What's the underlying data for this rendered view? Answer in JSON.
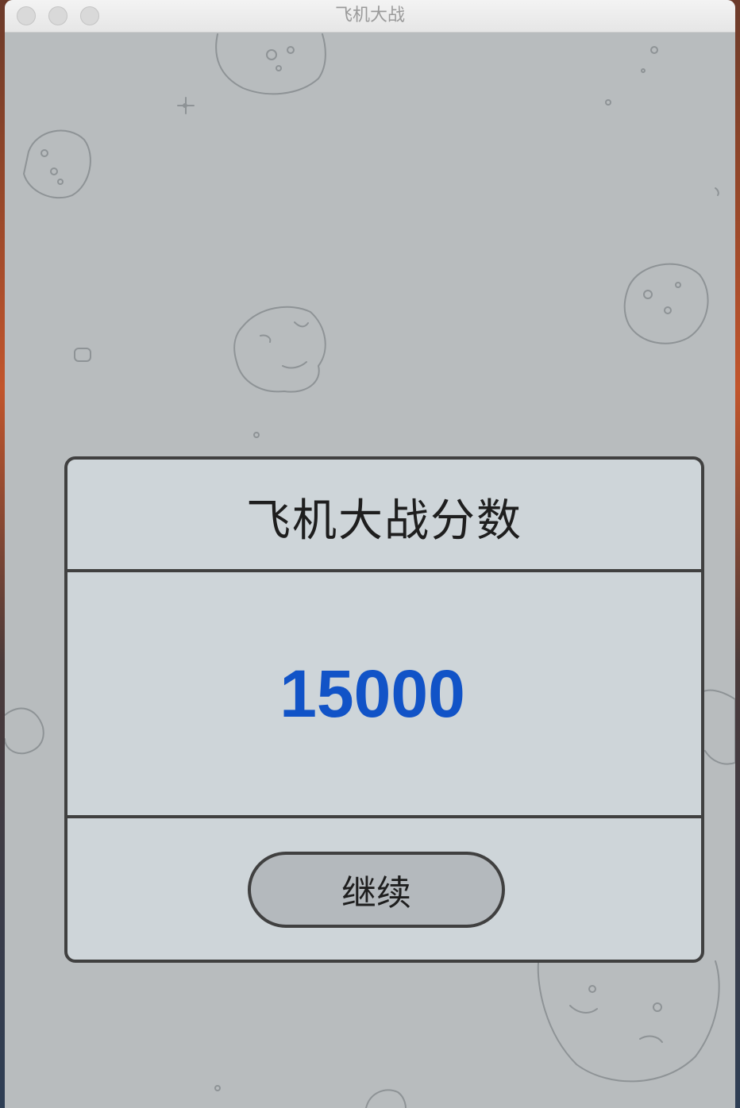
{
  "window": {
    "title": "飞机大战"
  },
  "score_dialog": {
    "title": "飞机大战分数",
    "score": "15000",
    "continue_label": "继续"
  },
  "icons": [
    "close-icon",
    "minimize-icon",
    "maximize-icon"
  ],
  "colors": {
    "background": "#b8bcbe",
    "dialog": "#ced5d9",
    "border": "#404040",
    "score": "#1153c7",
    "button": "#b4b9bd"
  }
}
